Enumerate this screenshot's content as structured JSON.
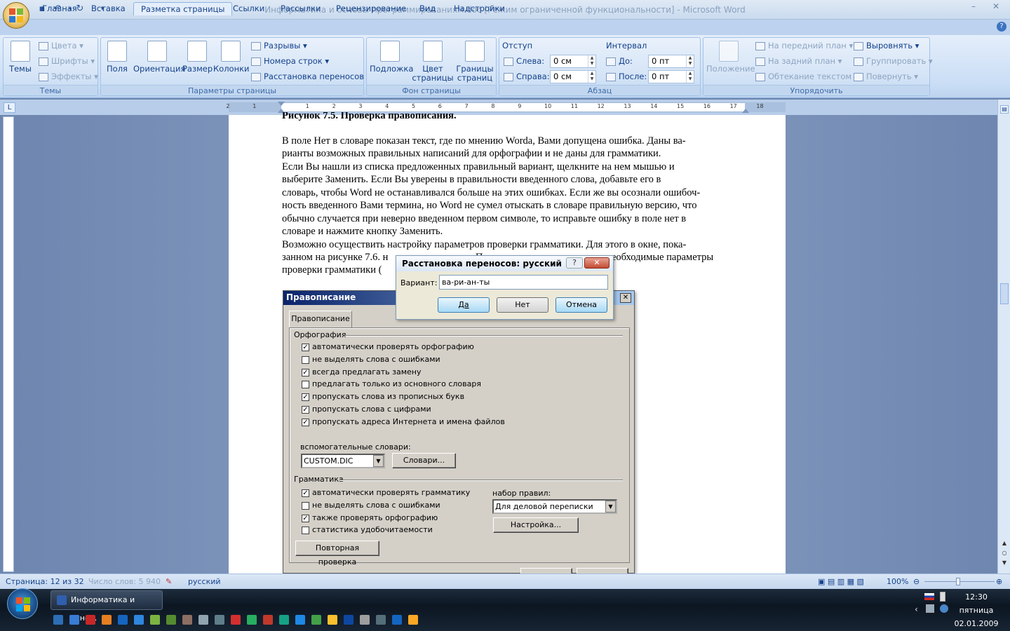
{
  "window": {
    "title": "Информатика и основы программированиям.doc [Режим ограниченной функциональности] - Microsoft Word"
  },
  "tabs": [
    "Главная",
    "Вставка",
    "Разметка страницы",
    "Ссылки",
    "Рассылки",
    "Рецензирование",
    "Вид",
    "Надстройки"
  ],
  "active_tab": "Разметка страницы",
  "ribbon": {
    "themes": {
      "big": "Темы",
      "colors": "Цвета",
      "fonts": "Шрифты",
      "effects": "Эффекты",
      "label": "Темы"
    },
    "page_setup": {
      "fields": "Поля",
      "orientation": "Ориентация",
      "size": "Размер",
      "columns": "Колонки",
      "breaks": "Разрывы",
      "line_numbers": "Номера строк",
      "hyphenation": "Расстановка переносов",
      "label": "Параметры страницы"
    },
    "page_background": {
      "watermark": "Подложка",
      "color": "Цвет страницы",
      "color_l1": "Цвет",
      "color_l2": "страницы",
      "borders_l1": "Границы",
      "borders_l2": "страниц",
      "label": "Фон страницы"
    },
    "paragraph": {
      "indent": "Отступ",
      "left": "Слева:",
      "left_val": "0 см",
      "right": "Справа:",
      "right_val": "0 см",
      "spacing": "Интервал",
      "before": "До:",
      "before_val": "0 пт",
      "after": "После:",
      "after_val": "0 пт",
      "label": "Абзац"
    },
    "arrange": {
      "position": "Положение",
      "front": "На передний план",
      "back": "На задний план",
      "wrap": "Обтекание текстом",
      "align": "Выровнять",
      "group": "Группировать",
      "rotate": "Повернуть",
      "label": "Упорядочить"
    }
  },
  "document": {
    "heading_fragment": "Рисунок 7.5. Проверка правописания.",
    "lines": [
      "В поле Нет в словаре показан текст, где по мнению Worda, Вами допущена ошибка. Даны ва-",
      "рианты возможных правильных написаний для орфографии и не даны для грамматики.",
      "Если Вы нашли из списка предложенных правильный вариант, щелкните на нем мышью и",
      "выберите Заменить.  Если Вы уверены в правильности введенного слова, добавьте его в",
      "словарь, чтобы Word не останавливался больше на этих ошибках. Если же вы осознали ошибоч-",
      "ность введенного Вами термина, но Word  не сумел отыскать в словаре правильную версию, что",
      "обычно случается при неверно введенном первом символе, то исправьте ошибку в поле нет в",
      "словаре и нажмите кнопку Заменить.",
      "Возможно осуществить настройку параметров проверки грамматики. Для этого в окне, пока-",
      "занном на рисунке 7.6. н",
      "проверки грамматики ("
    ],
    "line7_tail_a": "Па",
    "line7_tail_b": "еобходимые параметры"
  },
  "hyphen_dialog": {
    "title": "Расстановка переносов: русский",
    "variant_label": "Вариант:",
    "variant_value": "ва-ри-ан-ты",
    "yes": "Да",
    "no": "Нет",
    "cancel": "Отмена",
    "help_glyph": "?",
    "close_glyph": "✕"
  },
  "spelling_dialog": {
    "title": "Правописание",
    "tab": "Правописание",
    "spelling_section": "Орфография",
    "spelling_options": [
      {
        "label": "автоматически проверять орфографию",
        "checked": true
      },
      {
        "label": "не выделять слова с ошибками",
        "checked": false
      },
      {
        "label": "всегда предлагать замену",
        "checked": true
      },
      {
        "label": "предлагать только из основного словаря",
        "checked": false
      },
      {
        "label": "пропускать слова из прописных букв",
        "checked": true
      },
      {
        "label": "пропускать слова с цифрами",
        "checked": true
      },
      {
        "label": "пропускать адреса Интернета и имена файлов",
        "checked": true
      }
    ],
    "aux_dicts_label": "вспомогательные словари:",
    "aux_dict_value": "CUSTOM.DIC",
    "dicts_button": "Словари...",
    "grammar_section": "Грамматика",
    "grammar_options": [
      {
        "label": "автоматически проверять грамматику",
        "checked": true
      },
      {
        "label": "не выделять слова с ошибками",
        "checked": false
      },
      {
        "label": "также проверять орфографию",
        "checked": true
      },
      {
        "label": "статистика удобочитаемости",
        "checked": false
      }
    ],
    "ruleset_label": "набор правил:",
    "ruleset_value": "Для деловой переписки",
    "settings_button": "Настройка...",
    "recheck_button": "Повторная проверка"
  },
  "statusbar": {
    "page": "Страница: 12 из 32",
    "words": "Число слов: 5 940",
    "language": "русский",
    "zoom": "100%"
  },
  "taskbar": {
    "task": "Информатика и осно...",
    "time": "12:30",
    "day": "пятница",
    "date": "02.01.2009"
  },
  "ruler_numbers": [
    "2",
    "1",
    "1",
    "2",
    "3",
    "4",
    "5",
    "6",
    "7",
    "8",
    "9",
    "10",
    "11",
    "12",
    "13",
    "14",
    "15",
    "16",
    "17",
    "18"
  ],
  "colors": {
    "accent": "#15428b",
    "ribbon": "#c9ddf5",
    "dialog_title": "#0a246a",
    "workspace": "#6f87b0"
  }
}
